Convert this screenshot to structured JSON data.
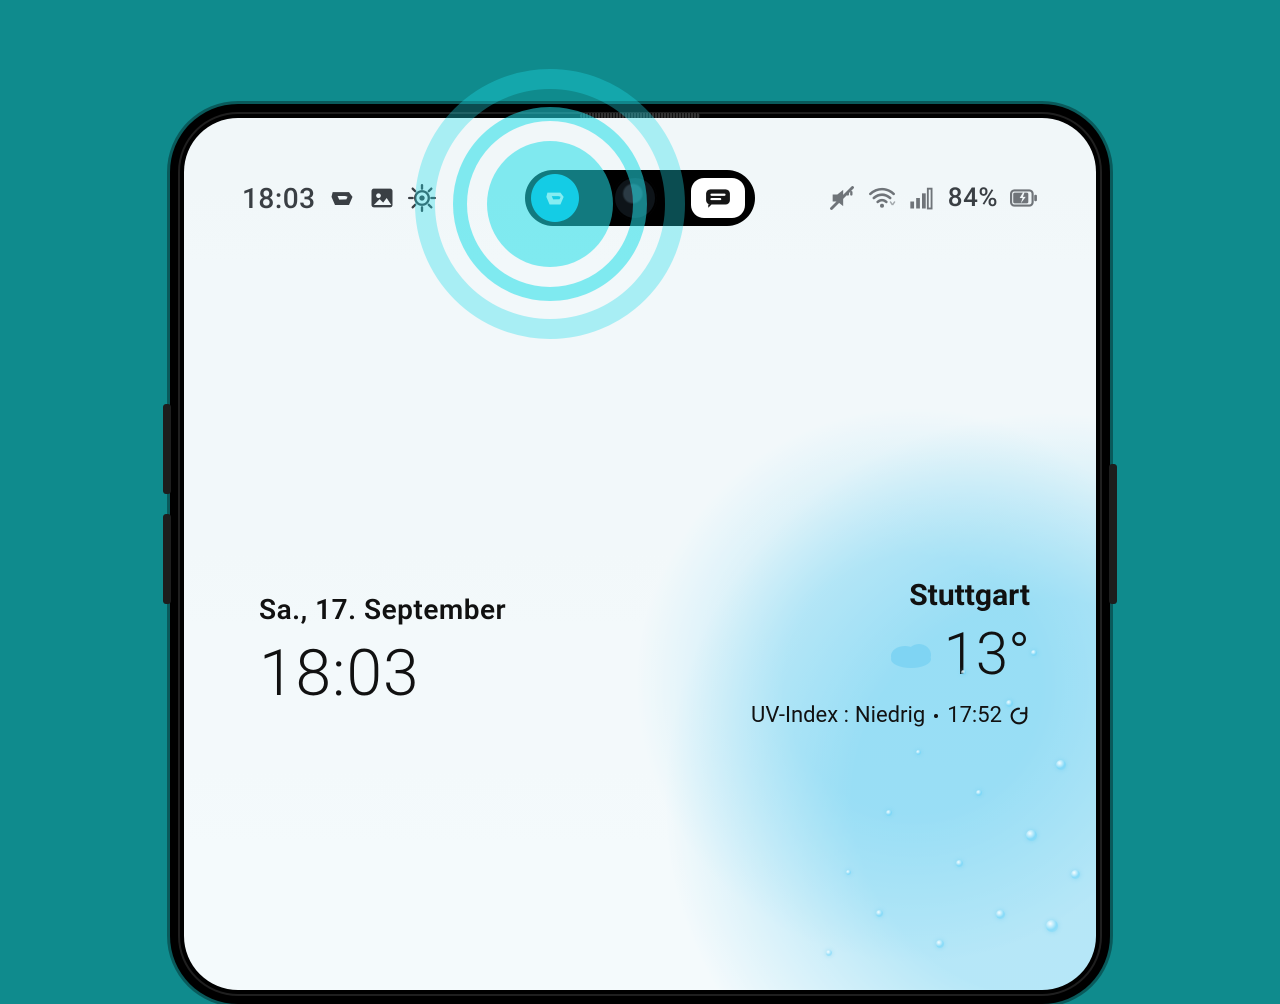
{
  "status_bar": {
    "clock": "18:03",
    "left_icons": [
      "app-glyph-icon",
      "gallery-icon",
      "bug-gear-icon"
    ],
    "right_icons": [
      "mute-icon",
      "wifi-icon",
      "cell-signal-icon"
    ],
    "battery_percent": "84%",
    "battery_icon": "battery-charging-icon"
  },
  "island": {
    "app_icon": "teal-app-icon",
    "message_icon": "message-icon"
  },
  "lockscreen": {
    "date": "Sa., 17. September",
    "time": "18:03"
  },
  "weather": {
    "city": "Stuttgart",
    "temp": "13°",
    "condition_icon": "cloud-icon",
    "uv_label": "UV-Index :",
    "uv_value": "Niedrig",
    "updated_at": "17:52",
    "refresh_icon": "refresh-icon"
  },
  "colors": {
    "page_bg": "#0f8b8d",
    "accent_teal": "#1ce0e8",
    "island_app": "#06b5e3"
  }
}
